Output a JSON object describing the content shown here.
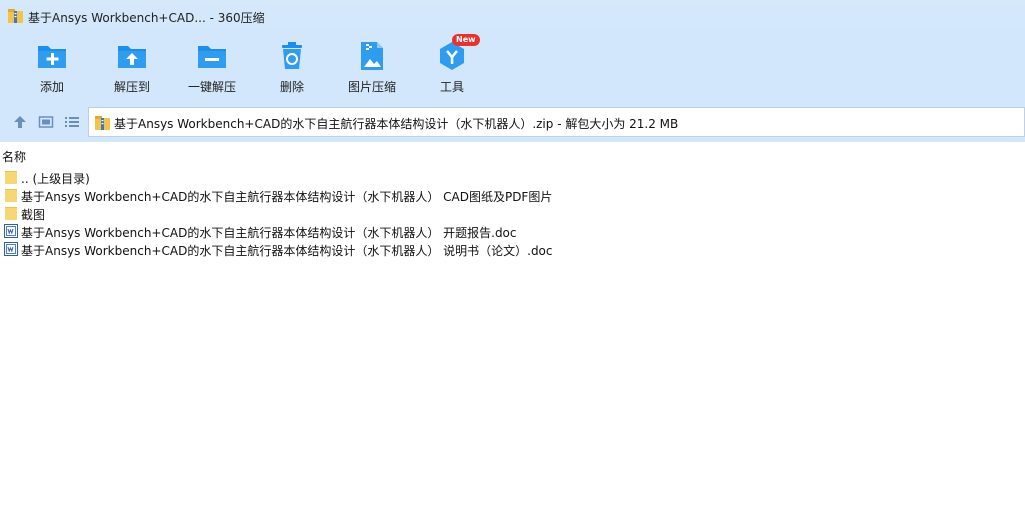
{
  "window": {
    "title": "基于Ansys Workbench+CAD... - 360压缩",
    "app_icon": "archive-icon"
  },
  "toolbar": {
    "items": [
      {
        "label": "添加",
        "icon": "add-folder-icon"
      },
      {
        "label": "解压到",
        "icon": "extract-to-folder-icon"
      },
      {
        "label": "一键解压",
        "icon": "one-click-extract-icon"
      },
      {
        "label": "删除",
        "icon": "trash-icon"
      },
      {
        "label": "图片压缩",
        "icon": "image-compress-icon"
      },
      {
        "label": "工具",
        "icon": "tools-icon",
        "badge": "New"
      }
    ]
  },
  "address": {
    "text": "基于Ansys Workbench+CAD的水下自主航行器本体结构设计（水下机器人）.zip - 解包大小为 21.2 MB"
  },
  "columns": {
    "name": "名称"
  },
  "files": [
    {
      "name": ".. (上级目录)",
      "type": "folder"
    },
    {
      "name": "基于Ansys Workbench+CAD的水下自主航行器本体结构设计（水下机器人） CAD图纸及PDF图片",
      "type": "folder"
    },
    {
      "name": "截图",
      "type": "folder"
    },
    {
      "name": "基于Ansys Workbench+CAD的水下自主航行器本体结构设计（水下机器人） 开题报告.doc",
      "type": "doc"
    },
    {
      "name": "基于Ansys Workbench+CAD的水下自主航行器本体结构设计（水下机器人） 说明书（论文）.doc",
      "type": "doc"
    }
  ],
  "colors": {
    "toolbar_bg": "#d2e7fb",
    "icon_blue": "#1e8ee8",
    "folder_yellow": "#f7d774",
    "badge_red": "#e8322f"
  }
}
